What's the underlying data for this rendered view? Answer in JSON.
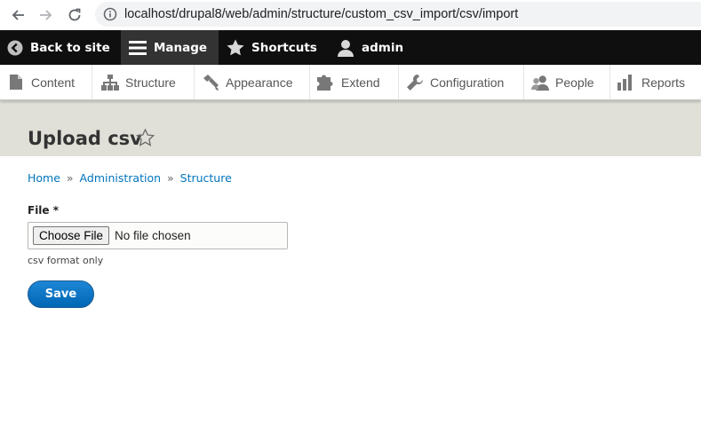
{
  "browser": {
    "url": "localhost/drupal8/web/admin/structure/custom_csv_import/csv/import"
  },
  "toolbar": {
    "back_label": "Back to site",
    "manage_label": "Manage",
    "shortcuts_label": "Shortcuts",
    "user_label": "admin"
  },
  "tray": {
    "items": [
      {
        "label": "Content",
        "icon": "file-icon"
      },
      {
        "label": "Structure",
        "icon": "sitemap-icon"
      },
      {
        "label": "Appearance",
        "icon": "brush-icon"
      },
      {
        "label": "Extend",
        "icon": "puzzle-icon"
      },
      {
        "label": "Configuration",
        "icon": "wrench-icon"
      },
      {
        "label": "People",
        "icon": "people-icon"
      },
      {
        "label": "Reports",
        "icon": "bar-chart-icon"
      }
    ]
  },
  "page": {
    "title": "Upload csv"
  },
  "breadcrumb": {
    "items": [
      "Home",
      "Administration",
      "Structure"
    ],
    "separator": "»"
  },
  "form": {
    "file_label": "File *",
    "choose_file_label": "Choose File",
    "no_file_text": "No file chosen",
    "description": "csv format only",
    "save_label": "Save"
  },
  "colors": {
    "toolbar_bg": "#0f0f0f",
    "manage_active_bg": "#333333",
    "header_bg": "#e0e0d8",
    "link": "#0074bd",
    "primary_button": "#0071b8"
  }
}
